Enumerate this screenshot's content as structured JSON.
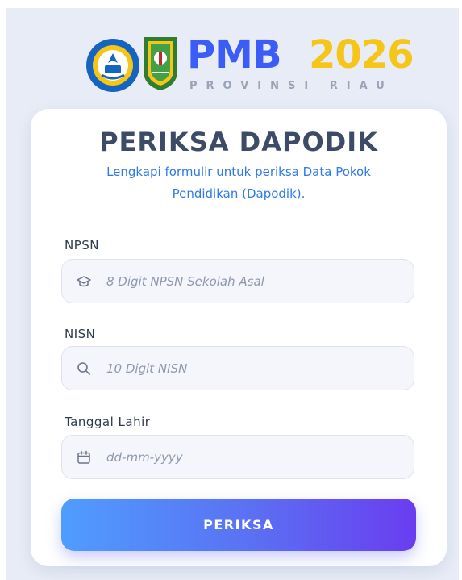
{
  "header": {
    "brand_pmb": "PMB",
    "brand_year": "2026",
    "brand_subtitle": "PROVINSI RIAU",
    "logos": [
      "kemdikbud-logo",
      "riau-province-logo"
    ]
  },
  "form": {
    "title": "PERIKSA DAPODIK",
    "subtitle": "Lengkapi formulir untuk periksa Data Pokok Pendidikan (Dapodik).",
    "fields": [
      {
        "label": "NPSN",
        "placeholder": "8 Digit NPSN Sekolah Asal",
        "value": "",
        "icon": "graduation-cap-icon"
      },
      {
        "label": "NISN",
        "placeholder": "10 Digit NISN",
        "value": "",
        "icon": "search-icon"
      },
      {
        "label": "Tanggal Lahir",
        "placeholder": "dd-mm-yyyy",
        "value": "",
        "icon": "calendar-icon"
      }
    ],
    "submit_label": "PERIKSA"
  },
  "colors": {
    "background": "#e7ecf6",
    "brand_blue": "#3b5cf5",
    "brand_yellow": "#f5c518",
    "subtitle_blue": "#2d7be8",
    "button_gradient_start": "#4f9dff",
    "button_gradient_end": "#6a3df0"
  }
}
